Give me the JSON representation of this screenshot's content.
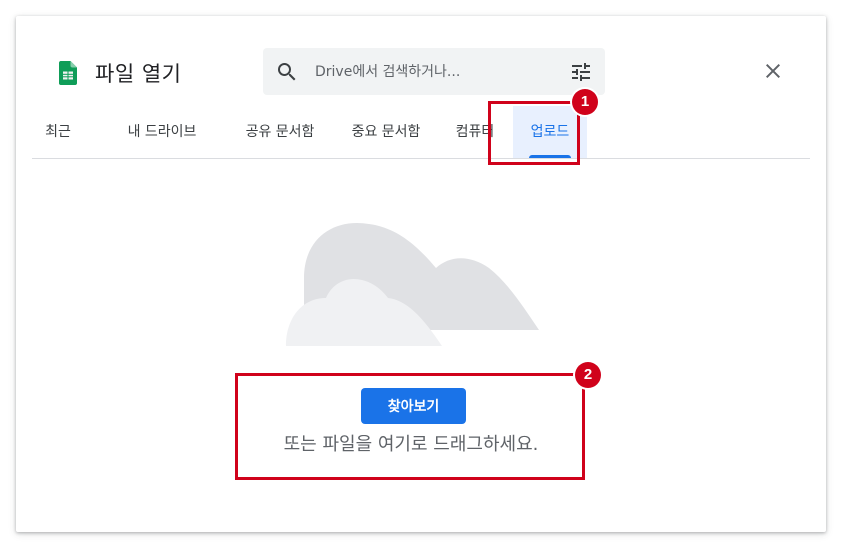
{
  "dialog": {
    "title": "파일 열기",
    "app_icon": "google-sheets-icon",
    "close_icon": "close-icon"
  },
  "search": {
    "placeholder": "Drive에서 검색하거나...",
    "value": "",
    "search_icon": "search-icon",
    "filter_icon": "tune-icon"
  },
  "tabs": [
    {
      "label": "최근",
      "active": false
    },
    {
      "label": "내 드라이브",
      "active": false
    },
    {
      "label": "공유 문서함",
      "active": false
    },
    {
      "label": "중요 문서함",
      "active": false
    },
    {
      "label": "컴퓨터",
      "active": false
    },
    {
      "label": "업로드",
      "active": true
    }
  ],
  "upload": {
    "illustration": "cloud-illustration",
    "browse_label": "찾아보기",
    "drag_text": "또는 파일을 여기로 드래그하세요."
  },
  "annotations": [
    {
      "number": "1"
    },
    {
      "number": "2"
    }
  ],
  "colors": {
    "accent": "#1a73e8",
    "active_tab_bg": "#e8f0fe",
    "annotation_red": "#d0021b",
    "sheets_green": "#0f9d58",
    "text_primary": "#202124",
    "text_secondary": "#5f6368",
    "divider": "#dadce0",
    "search_bg": "#f1f3f4"
  }
}
